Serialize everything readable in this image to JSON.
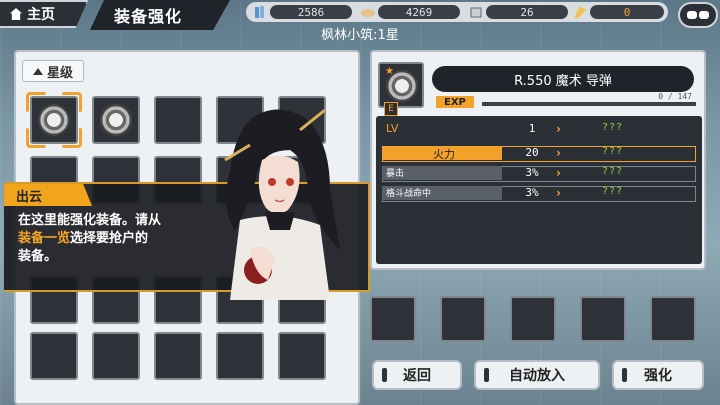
{
  "topbar": {
    "home_label": "主页",
    "title": "装备强化",
    "resources": [
      {
        "icon": "ammo-icon",
        "value": "2586"
      },
      {
        "icon": "ration-icon",
        "value": "4269"
      },
      {
        "icon": "part-icon",
        "value": "26"
      },
      {
        "icon": "gem-icon",
        "value": "0"
      }
    ],
    "subtitle": "枫林小筑:1星"
  },
  "left_panel": {
    "star_label": "星级"
  },
  "dialog": {
    "speaker": "出云",
    "line1": "在这里能强化装备。请从",
    "highlight": "装备一览",
    "line2_rest": "选择要抢户的",
    "line3": "装备。"
  },
  "equipment": {
    "rank": "E",
    "name": "R.550 魔术 导弹",
    "exp_label": "EXP",
    "exp_value": "0 / 147",
    "exp_fraction": 0.0
  },
  "stats": [
    {
      "name": "LV",
      "value": "1",
      "new": "???",
      "style": "plain"
    },
    {
      "name": "火力",
      "value": "20",
      "new": "???",
      "style": "hi"
    },
    {
      "name": "暴击",
      "value": "3%",
      "new": "???",
      "style": "bar"
    },
    {
      "name": "格斗战命中",
      "value": "3%",
      "new": "???",
      "style": "bar"
    }
  ],
  "buttons": {
    "back": "返回",
    "auto": "自动放入",
    "enhance": "强化"
  },
  "colors": {
    "accent": "#f2a12a",
    "panel": "#eef1f4",
    "dark": "#2b2f36"
  }
}
